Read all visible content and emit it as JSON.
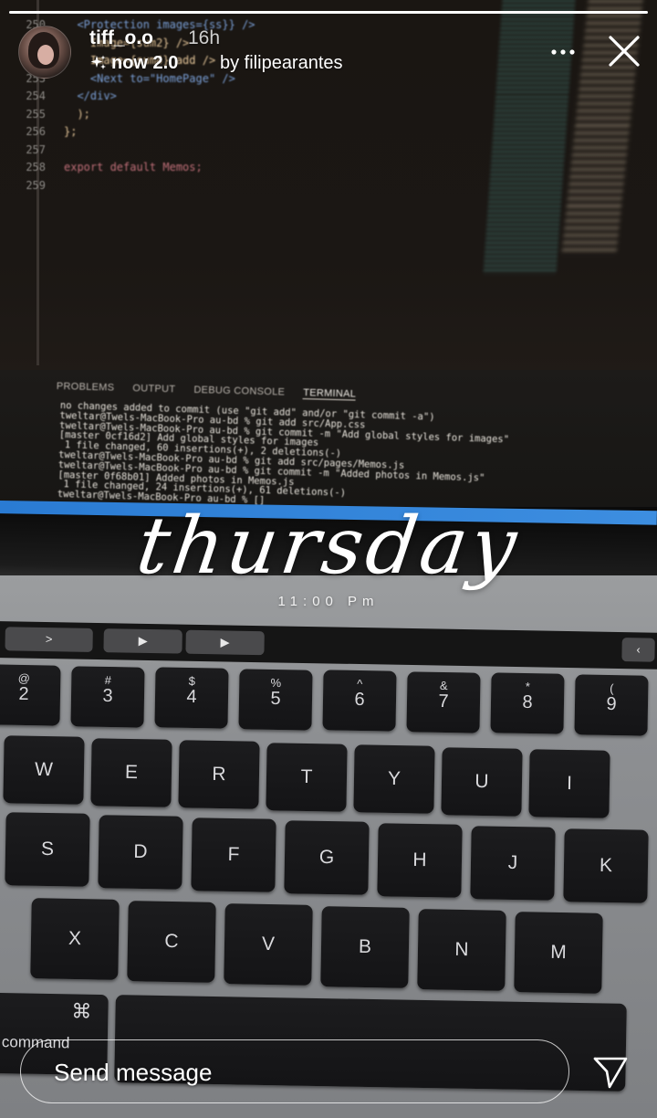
{
  "story": {
    "progress_fraction": 1.0,
    "username": "tiff_o.o",
    "time_ago": "16h",
    "music": {
      "icon": "sparkle-icon",
      "title": "now 2.0",
      "by": "by filipearantes"
    },
    "more_icon": "more-icon",
    "close_icon": "close-icon"
  },
  "overlay": {
    "day": "thursday",
    "time": "11:00 Pm"
  },
  "footer": {
    "message_placeholder": "Send message",
    "send_icon": "send-icon"
  },
  "photo": {
    "code": {
      "line_numbers": [
        "250",
        "251",
        "252",
        "253",
        "254",
        "255",
        "256",
        "257",
        "258",
        "259"
      ],
      "lines": [
        "  <Protection images={ss}} />",
        "    Image={sum2} />",
        "    Image={sum4} add />",
        "    <Next to=\"HomePage\" />",
        "  </div>",
        "  );",
        "};",
        "",
        "export default Memos;",
        ""
      ]
    },
    "terminal": {
      "tabs": [
        "PROBLEMS",
        "OUTPUT",
        "DEBUG CONSOLE",
        "TERMINAL"
      ],
      "active_tab": "TERMINAL",
      "lines": [
        "no changes added to commit (use \"git add\" and/or \"git commit -a\")",
        "tweltar@Twels-MacBook-Pro au-bd % git add src/App.css",
        "tweltar@Twels-MacBook-Pro au-bd % git commit -m \"Add global styles for images\"",
        "[master 0cf16d2] Add global styles for images",
        " 1 file changed, 60 insertions(+), 2 deletions(-)",
        "tweltar@Twels-MacBook-Pro au-bd % git add src/pages/Memos.js",
        "tweltar@Twels-MacBook-Pro au-bd % git commit -m \"Added photos in Memos.js\"",
        "[master 0f68b01] Added photos in Memos.js",
        " 1 file changed, 24 insertions(+), 61 deletions(-)",
        "tweltar@Twels-MacBook-Pro au-bd % []"
      ]
    },
    "touchbar": [
      ">",
      "▶",
      "▶"
    ],
    "keys": {
      "row1": [
        {
          "sym": "@",
          "num": "2"
        },
        {
          "sym": "#",
          "num": "3"
        },
        {
          "sym": "$",
          "num": "4"
        },
        {
          "sym": "%",
          "num": "5"
        },
        {
          "sym": "^",
          "num": "6"
        },
        {
          "sym": "&",
          "num": "7"
        },
        {
          "sym": "*",
          "num": "8"
        },
        {
          "sym": "(",
          "num": "9"
        }
      ],
      "row2": [
        "W",
        "E",
        "R",
        "T",
        "Y",
        "U",
        "I"
      ],
      "row3": [
        "S",
        "D",
        "F",
        "G",
        "H",
        "J",
        "K"
      ],
      "row4": [
        "X",
        "C",
        "V",
        "B",
        "N",
        "M"
      ],
      "command_symbol": "⌘",
      "command_label": "command"
    }
  }
}
